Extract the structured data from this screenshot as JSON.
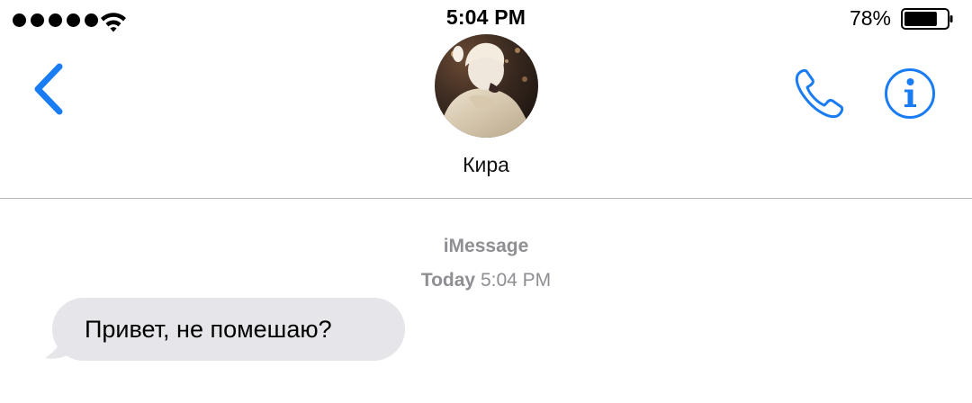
{
  "status_bar": {
    "signal_dots": 5,
    "time": "5:04 PM",
    "battery_percent": "78%",
    "battery_level": 0.78
  },
  "header": {
    "back_icon": "chevron-left-icon",
    "contact_name": "Кира",
    "avatar": "contact-photo",
    "phone_icon": "phone-icon",
    "info_icon": "info-icon"
  },
  "conversation": {
    "service": "iMessage",
    "timestamp_day": "Today",
    "timestamp_time": "5:04 PM",
    "messages": [
      {
        "direction": "incoming",
        "text": "Привет, не помешаю?"
      }
    ]
  },
  "colors": {
    "accent": "#1a7cf5",
    "incoming_bubble": "#e5e5ea",
    "secondary_text": "#8e8e93",
    "divider": "#b8b8bc"
  }
}
